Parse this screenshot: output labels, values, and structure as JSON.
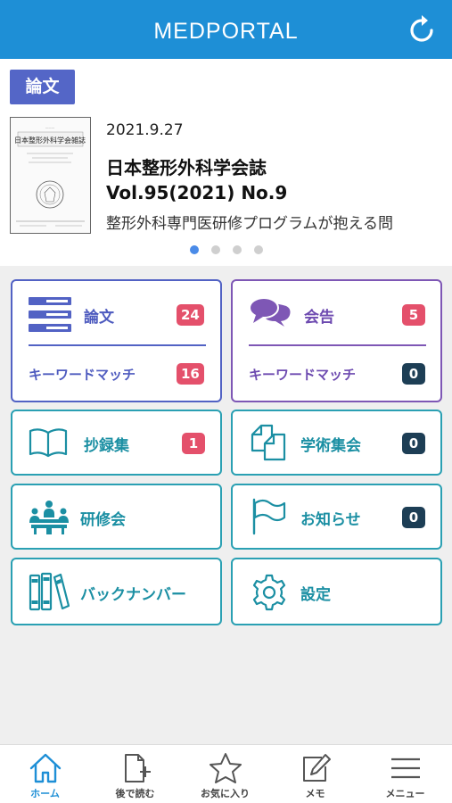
{
  "header": {
    "title": "MEDPORTAL",
    "refresh_icon": "refresh-icon"
  },
  "featured": {
    "category": "論文",
    "date": "2021.9.27",
    "journal_title_line1": "日本整形外科学会誌",
    "journal_title_line2": "Vol.95(2021) No.9",
    "article_title": "整形外科専門医研修プログラムが抱える問",
    "cover_title": "日本整形外科学会雑誌",
    "carousel": {
      "count": 4,
      "active_index": 0
    }
  },
  "menu": {
    "papers": {
      "label": "論文",
      "count": "24",
      "keyword_label": "キーワードマッチ",
      "keyword_count": "16",
      "icon": "list-icon"
    },
    "notices": {
      "label": "会告",
      "count": "5",
      "keyword_label": "キーワードマッチ",
      "keyword_count": "0",
      "icon": "chat-bubbles-icon"
    },
    "abstracts": {
      "label": "抄録集",
      "count": "1",
      "icon": "open-book-icon"
    },
    "meetings": {
      "label": "学術集会",
      "count": "0",
      "icon": "documents-icon"
    },
    "training": {
      "label": "研修会",
      "icon": "group-meeting-icon"
    },
    "news": {
      "label": "お知らせ",
      "count": "0",
      "icon": "flag-icon"
    },
    "back_numbers": {
      "label": "バックナンバー",
      "icon": "books-icon"
    },
    "settings": {
      "label": "設定",
      "icon": "gear-icon"
    }
  },
  "tabbar": {
    "home": "ホーム",
    "read_later": "後で読む",
    "favorites": "お気に入り",
    "memo": "メモ",
    "menu": "メニュー"
  },
  "colors": {
    "header": "#1e8fd6",
    "papers_accent": "#5262c4",
    "notices_accent": "#7e57b5",
    "teal_accent": "#2aa0b3",
    "badge_red": "#e4506b",
    "badge_dark": "#1d3e55"
  }
}
